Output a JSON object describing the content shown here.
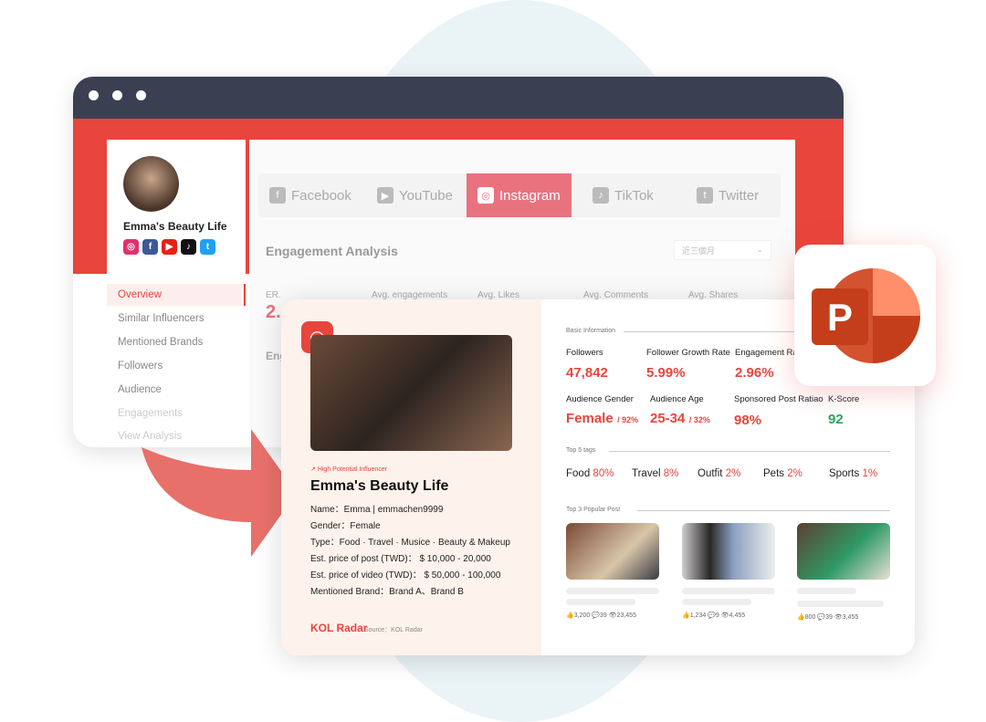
{
  "profile": {
    "name": "Emma's Beauty Life"
  },
  "sidebar": {
    "items": [
      "Overview",
      "Similar Influencers",
      "Mentioned Brands",
      "Followers",
      "Audience",
      "Engagements",
      "View Analysis"
    ],
    "active": "Overview"
  },
  "tabs": [
    {
      "label": "Facebook",
      "icon": "facebook-icon"
    },
    {
      "label": "YouTube",
      "icon": "youtube-icon"
    },
    {
      "label": "Instagram",
      "icon": "instagram-icon",
      "active": true
    },
    {
      "label": "TikTok",
      "icon": "tiktok-icon"
    },
    {
      "label": "Twitter",
      "icon": "twitter-icon"
    }
  ],
  "engagement": {
    "title": "Engagement Analysis",
    "range": "近三個月",
    "metrics": [
      "ER.",
      "Avg. engagements",
      "Avg. Likes",
      "Avg. Comments",
      "Avg. Shares"
    ],
    "er_value": "2.",
    "sub": "Eng"
  },
  "report": {
    "badge": "High Potential Influencer",
    "name": "Emma's Beauty Life",
    "details": [
      "Name：Emma | emmachen9999",
      "Gender：Female",
      "Type：Food · Travel · Musice · Beauty & Makeup",
      "Est. price of post (TWD)： $ 10,000 - 20,000",
      "Est. price of video (TWD)： $ 50,000 - 100,000",
      "Mentioned Brand：Brand A、Brand B"
    ],
    "logo": "KOL Radar",
    "source": "Source：KOL Radar",
    "basic_title": "Basic Information",
    "followers_label": "Followers",
    "followers": "47,842",
    "growth_label": "Follower Growth Rate",
    "growth": "5.99%",
    "er_label": "Engagement Ra",
    "er": "2.96%",
    "gender_label": "Audience Gender",
    "gender": "Female",
    "gender_pct": "/ 92%",
    "age_label": "Audience Age",
    "age": "25-34",
    "age_pct": "/ 32%",
    "sponsored_label": "Sponsored Post Ratiao",
    "sponsored": "98%",
    "kscore_label": "K-Score",
    "kscore": "92",
    "tags_title": "Top 5 tags",
    "tags": [
      {
        "name": "Food",
        "pct": "80%"
      },
      {
        "name": "Travel",
        "pct": "8%"
      },
      {
        "name": "Outfit",
        "pct": "2%"
      },
      {
        "name": "Pets",
        "pct": "2%"
      },
      {
        "name": "Sports",
        "pct": "1%"
      }
    ],
    "posts_title": "Top 3 Popular Post",
    "posts": [
      {
        "likes": "3,200",
        "comments": "39",
        "views": "23,455"
      },
      {
        "likes": "1,234",
        "comments": "9",
        "views": "4,455"
      },
      {
        "likes": "800",
        "comments": "39",
        "views": "3,455"
      }
    ]
  },
  "colors": {
    "accent": "#e8453c",
    "green": "#2ea55e",
    "titlebar": "#3b3f52"
  }
}
